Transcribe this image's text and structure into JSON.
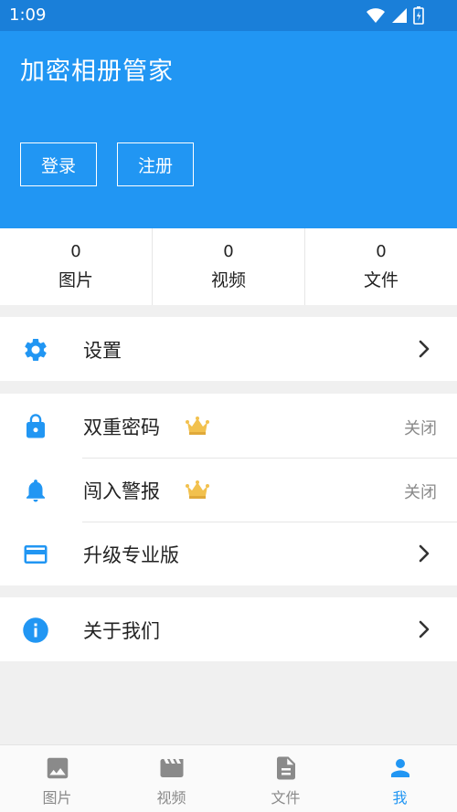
{
  "status_bar": {
    "time": "1:09"
  },
  "header": {
    "title": "加密相册管家",
    "login_label": "登录",
    "register_label": "注册"
  },
  "stats": [
    {
      "count": "0",
      "label": "图片"
    },
    {
      "count": "0",
      "label": "视频"
    },
    {
      "count": "0",
      "label": "文件"
    }
  ],
  "menu": {
    "settings": {
      "label": "设置",
      "icon": "gear-icon"
    },
    "two_factor": {
      "label": "双重密码",
      "value": "关闭",
      "icon": "lock-icon",
      "badge": "crown-icon"
    },
    "intrusion_alert": {
      "label": "闯入警报",
      "value": "关闭",
      "icon": "bell-icon",
      "badge": "crown-icon"
    },
    "upgrade": {
      "label": "升级专业版",
      "icon": "credit-card-icon"
    },
    "about": {
      "label": "关于我们",
      "icon": "info-icon"
    }
  },
  "tabs": [
    {
      "label": "图片",
      "icon": "image-icon",
      "active": false
    },
    {
      "label": "视频",
      "icon": "movie-icon",
      "active": false
    },
    {
      "label": "文件",
      "icon": "file-icon",
      "active": false
    },
    {
      "label": "我",
      "icon": "person-icon",
      "active": true
    }
  ],
  "colors": {
    "primary": "#2196f3",
    "status_bar": "#1a7fd9",
    "crown": "#f2c14e",
    "inactive": "#8a8a8a"
  }
}
